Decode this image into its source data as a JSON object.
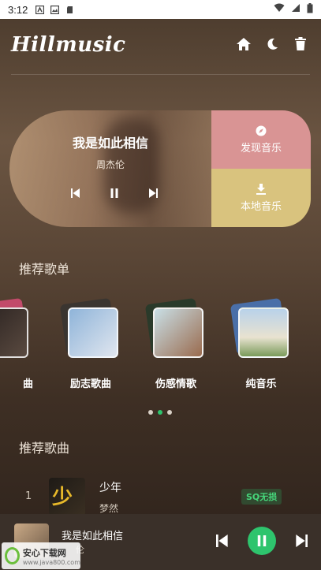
{
  "status_bar": {
    "time": "3:12"
  },
  "header": {
    "logo": "Hillmusic",
    "icons": [
      "home-icon",
      "moon-icon",
      "trash-icon"
    ]
  },
  "now_playing_card": {
    "title": "我是如此相信",
    "artist": "周杰伦"
  },
  "nav": {
    "discover_label": "发现音乐",
    "local_label": "本地音乐",
    "discover_color": "#d99494",
    "local_color": "#d9c37e"
  },
  "playlists_section": {
    "title": "推荐歌单"
  },
  "playlists": [
    {
      "label": "曲"
    },
    {
      "label": "励志歌曲"
    },
    {
      "label": "伤感情歌"
    },
    {
      "label": "纯音乐"
    }
  ],
  "pager": {
    "count": 3,
    "active": 1
  },
  "songs_section": {
    "title": "推荐歌曲"
  },
  "songs": [
    {
      "index": "1",
      "title": "少年",
      "artist": "梦然",
      "badge": "SQ无损"
    }
  ],
  "mini_player": {
    "title": "我是如此相信",
    "artist": "伦"
  },
  "watermark": {
    "main": "安心下载网",
    "url": "www.java800.com"
  },
  "colors": {
    "accent": "#2ec46d"
  }
}
